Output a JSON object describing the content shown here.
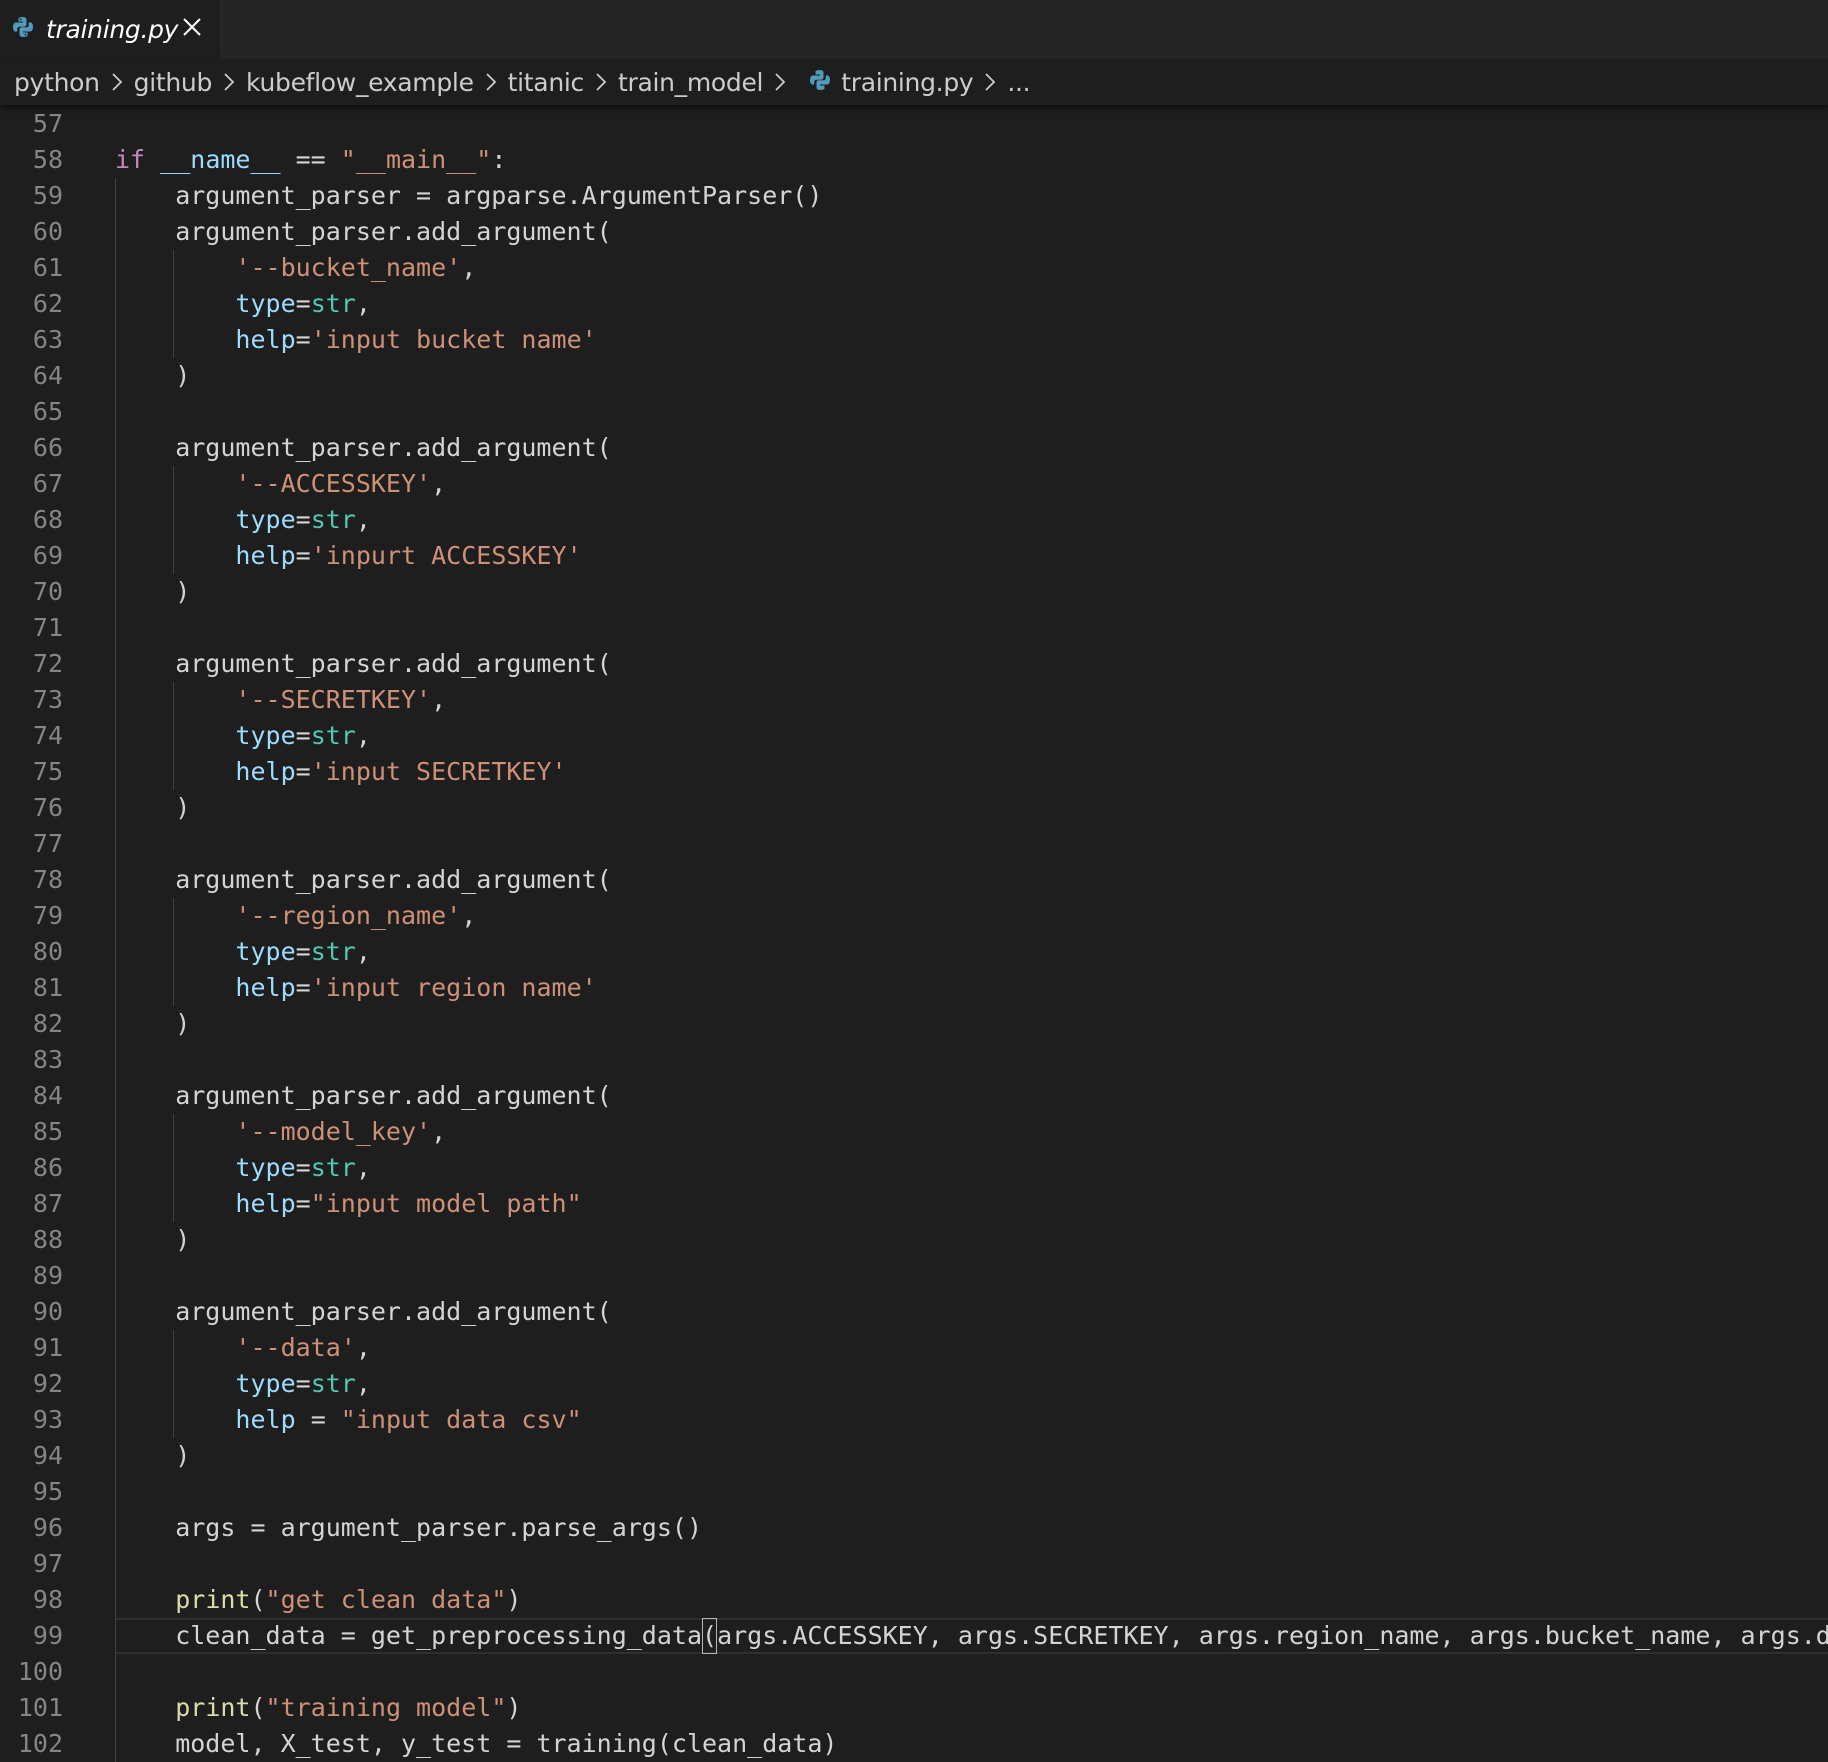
{
  "tab": {
    "title": "training.py",
    "icon": "python-icon"
  },
  "breadcrumb": {
    "items": [
      "python",
      "github",
      "kubeflow_example",
      "titanic",
      "train_model"
    ],
    "file": "training.py",
    "more": "..."
  },
  "colors": {
    "background": "#1e1e1e",
    "keyword": "#c586c0",
    "variable": "#9cdcfe",
    "string": "#ce9178",
    "type": "#4ec9b0",
    "function": "#dcdcaa",
    "default": "#d4d4d4",
    "line_number": "#858585"
  },
  "editor": {
    "lines": [
      {
        "num": "57",
        "tokens": []
      },
      {
        "num": "58",
        "tokens": [
          [
            "kw",
            "if"
          ],
          [
            "",
            ""
          ],
          [
            "",
            ""
          ],
          [
            "var",
            " __name__"
          ],
          [
            "",
            " == "
          ],
          [
            "str",
            "\"__main__\""
          ],
          [
            "",
            ":"
          ]
        ]
      },
      {
        "num": "59",
        "tokens": [
          [
            "",
            "    argument_parser = argparse.ArgumentParser()"
          ]
        ]
      },
      {
        "num": "60",
        "tokens": [
          [
            "",
            "    argument_parser.add_argument("
          ]
        ]
      },
      {
        "num": "61",
        "tokens": [
          [
            "",
            "        "
          ],
          [
            "str",
            "'--bucket_name'"
          ],
          [
            "",
            ","
          ]
        ]
      },
      {
        "num": "62",
        "tokens": [
          [
            "",
            "        "
          ],
          [
            "var",
            "type"
          ],
          [
            "",
            "="
          ],
          [
            "typ",
            "str"
          ],
          [
            "",
            ","
          ]
        ]
      },
      {
        "num": "63",
        "tokens": [
          [
            "",
            "        "
          ],
          [
            "var",
            "help"
          ],
          [
            "",
            "="
          ],
          [
            "str",
            "'input bucket name'"
          ]
        ]
      },
      {
        "num": "64",
        "tokens": [
          [
            "",
            "    )"
          ]
        ]
      },
      {
        "num": "65",
        "tokens": []
      },
      {
        "num": "66",
        "tokens": [
          [
            "",
            "    argument_parser.add_argument("
          ]
        ]
      },
      {
        "num": "67",
        "tokens": [
          [
            "",
            "        "
          ],
          [
            "str",
            "'--ACCESSKEY'"
          ],
          [
            "",
            ","
          ]
        ]
      },
      {
        "num": "68",
        "tokens": [
          [
            "",
            "        "
          ],
          [
            "var",
            "type"
          ],
          [
            "",
            "="
          ],
          [
            "typ",
            "str"
          ],
          [
            "",
            ","
          ]
        ]
      },
      {
        "num": "69",
        "tokens": [
          [
            "",
            "        "
          ],
          [
            "var",
            "help"
          ],
          [
            "",
            "="
          ],
          [
            "str",
            "'inpurt ACCESSKEY'"
          ]
        ]
      },
      {
        "num": "70",
        "tokens": [
          [
            "",
            "    )"
          ]
        ]
      },
      {
        "num": "71",
        "tokens": []
      },
      {
        "num": "72",
        "tokens": [
          [
            "",
            "    argument_parser.add_argument("
          ]
        ]
      },
      {
        "num": "73",
        "tokens": [
          [
            "",
            "        "
          ],
          [
            "str",
            "'--SECRETKEY'"
          ],
          [
            "",
            ","
          ]
        ]
      },
      {
        "num": "74",
        "tokens": [
          [
            "",
            "        "
          ],
          [
            "var",
            "type"
          ],
          [
            "",
            "="
          ],
          [
            "typ",
            "str"
          ],
          [
            "",
            ","
          ]
        ]
      },
      {
        "num": "75",
        "tokens": [
          [
            "",
            "        "
          ],
          [
            "var",
            "help"
          ],
          [
            "",
            "="
          ],
          [
            "str",
            "'input SECRETKEY'"
          ]
        ]
      },
      {
        "num": "76",
        "tokens": [
          [
            "",
            "    )"
          ]
        ]
      },
      {
        "num": "77",
        "tokens": []
      },
      {
        "num": "78",
        "tokens": [
          [
            "",
            "    argument_parser.add_argument("
          ]
        ]
      },
      {
        "num": "79",
        "tokens": [
          [
            "",
            "        "
          ],
          [
            "str",
            "'--region_name'"
          ],
          [
            "",
            ","
          ]
        ]
      },
      {
        "num": "80",
        "tokens": [
          [
            "",
            "        "
          ],
          [
            "var",
            "type"
          ],
          [
            "",
            "="
          ],
          [
            "typ",
            "str"
          ],
          [
            "",
            ","
          ]
        ]
      },
      {
        "num": "81",
        "tokens": [
          [
            "",
            "        "
          ],
          [
            "var",
            "help"
          ],
          [
            "",
            "="
          ],
          [
            "str",
            "'input region name'"
          ]
        ]
      },
      {
        "num": "82",
        "tokens": [
          [
            "",
            "    )"
          ]
        ]
      },
      {
        "num": "83",
        "tokens": []
      },
      {
        "num": "84",
        "tokens": [
          [
            "",
            "    argument_parser.add_argument("
          ]
        ]
      },
      {
        "num": "85",
        "tokens": [
          [
            "",
            "        "
          ],
          [
            "str",
            "'--model_key'"
          ],
          [
            "",
            ","
          ]
        ]
      },
      {
        "num": "86",
        "tokens": [
          [
            "",
            "        "
          ],
          [
            "var",
            "type"
          ],
          [
            "",
            "="
          ],
          [
            "typ",
            "str"
          ],
          [
            "",
            ","
          ]
        ]
      },
      {
        "num": "87",
        "tokens": [
          [
            "",
            "        "
          ],
          [
            "var",
            "help"
          ],
          [
            "",
            "="
          ],
          [
            "str",
            "\"input model path\""
          ]
        ]
      },
      {
        "num": "88",
        "tokens": [
          [
            "",
            "    )"
          ]
        ]
      },
      {
        "num": "89",
        "tokens": []
      },
      {
        "num": "90",
        "tokens": [
          [
            "",
            "    argument_parser.add_argument("
          ]
        ]
      },
      {
        "num": "91",
        "tokens": [
          [
            "",
            "        "
          ],
          [
            "str",
            "'--data'"
          ],
          [
            "",
            ","
          ]
        ]
      },
      {
        "num": "92",
        "tokens": [
          [
            "",
            "        "
          ],
          [
            "var",
            "type"
          ],
          [
            "",
            "="
          ],
          [
            "typ",
            "str"
          ],
          [
            "",
            ","
          ]
        ]
      },
      {
        "num": "93",
        "tokens": [
          [
            "",
            "        "
          ],
          [
            "var",
            "help"
          ],
          [
            "",
            " = "
          ],
          [
            "str",
            "\"input data csv\""
          ]
        ]
      },
      {
        "num": "94",
        "tokens": [
          [
            "",
            "    )"
          ]
        ]
      },
      {
        "num": "95",
        "tokens": []
      },
      {
        "num": "96",
        "tokens": [
          [
            "",
            "    args = argument_parser.parse_args()"
          ]
        ]
      },
      {
        "num": "97",
        "tokens": []
      },
      {
        "num": "98",
        "tokens": [
          [
            "",
            "    "
          ],
          [
            "fn",
            "print"
          ],
          [
            "",
            "("
          ],
          [
            "str",
            "\"get clean data\""
          ],
          [
            "",
            ")"
          ]
        ]
      },
      {
        "num": "99",
        "tokens": [
          [
            "",
            "    clean_data = get_preprocessing_data"
          ],
          [
            "box",
            "("
          ],
          [
            "",
            "args.ACCESSKEY, args.SECRETKEY, args.region_name, args.bucket_name, args.data"
          ],
          [
            "box",
            ")"
          ]
        ]
      },
      {
        "num": "100",
        "tokens": []
      },
      {
        "num": "101",
        "tokens": [
          [
            "",
            "    "
          ],
          [
            "fn",
            "print"
          ],
          [
            "",
            "("
          ],
          [
            "str",
            "\"training model\""
          ],
          [
            "",
            ")"
          ]
        ]
      },
      {
        "num": "102",
        "tokens": [
          [
            "",
            "    model, X_test, y_test = training(clean_data)"
          ]
        ]
      }
    ],
    "current_line": "99"
  }
}
